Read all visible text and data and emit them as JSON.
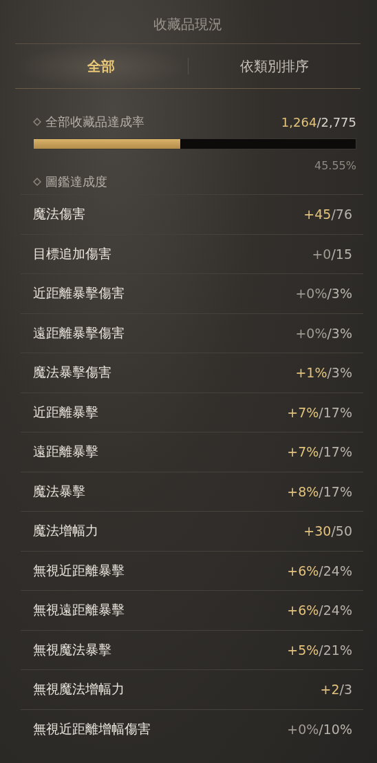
{
  "title": "收藏品現況",
  "tabs": [
    {
      "label": "全部",
      "selected": true
    },
    {
      "label": "依類別排序",
      "selected": false
    }
  ],
  "total": {
    "label": "全部收藏品達成率",
    "current": "1,264",
    "max": "/2,775",
    "level": 0.4555,
    "percent": "45.55%"
  },
  "codex": {
    "label": "圖鑑達成度",
    "rows": [
      {
        "name": "魔法傷害",
        "current": "+45",
        "max": "/76",
        "achieved": true
      },
      {
        "name": "目標追加傷害",
        "current": "+0",
        "max": "/15",
        "achieved": false
      },
      {
        "name": "近距離暴擊傷害",
        "current": "+0%",
        "max": "/3%",
        "achieved": false
      },
      {
        "name": "遠距離暴擊傷害",
        "current": "+0%",
        "max": "/3%",
        "achieved": false
      },
      {
        "name": "魔法暴擊傷害",
        "current": "+1%",
        "max": "/3%",
        "achieved": true
      },
      {
        "name": "近距離暴擊",
        "current": "+7%",
        "max": "/17%",
        "achieved": true
      },
      {
        "name": "遠距離暴擊",
        "current": "+7%",
        "max": "/17%",
        "achieved": true
      },
      {
        "name": "魔法暴擊",
        "current": "+8%",
        "max": "/17%",
        "achieved": true
      },
      {
        "name": "魔法增幅力",
        "current": "+30",
        "max": "/50",
        "achieved": true
      },
      {
        "name": "無視近距離暴擊",
        "current": "+6%",
        "max": "/24%",
        "achieved": true
      },
      {
        "name": "無視遠距離暴擊",
        "current": "+6%",
        "max": "/24%",
        "achieved": true
      },
      {
        "name": "無視魔法暴擊",
        "current": "+5%",
        "max": "/21%",
        "achieved": true
      },
      {
        "name": "無視魔法增幅力",
        "current": "+2",
        "max": "/3",
        "achieved": true
      },
      {
        "name": "無視近距離增幅傷害",
        "current": "+0%",
        "max": "/10%",
        "achieved": false
      }
    ]
  }
}
